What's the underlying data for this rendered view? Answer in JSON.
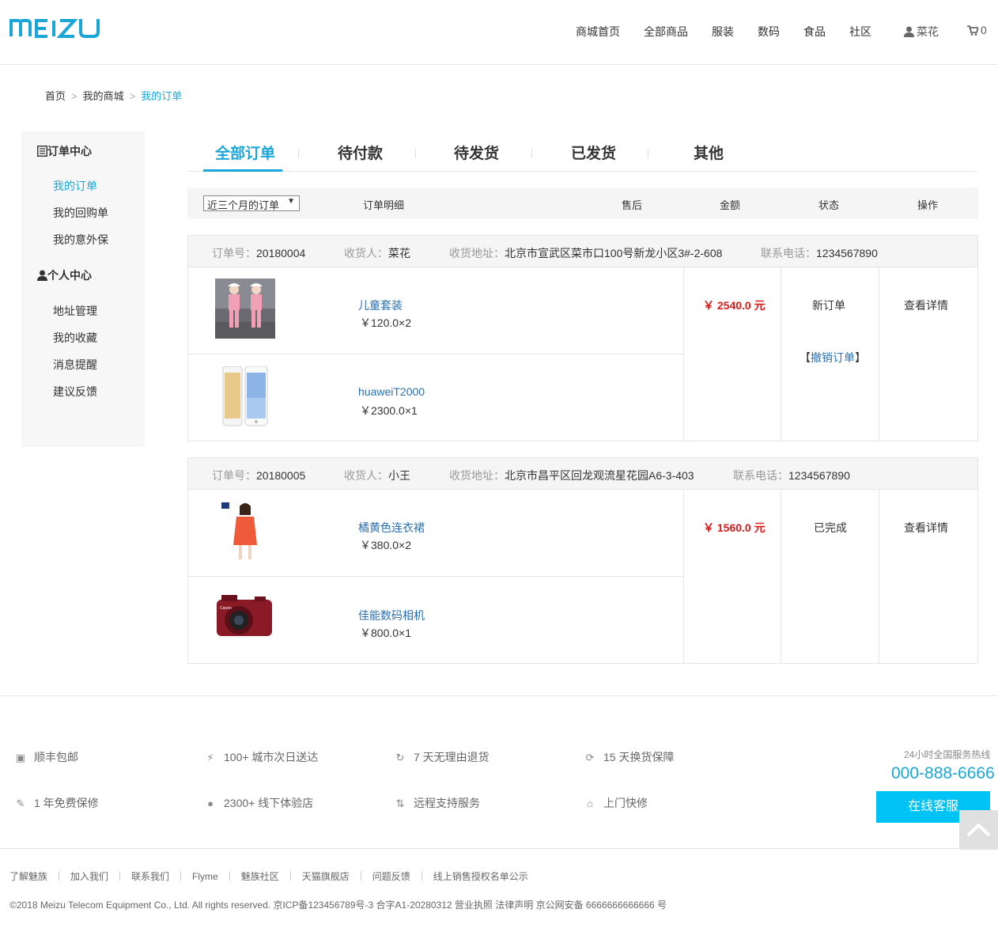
{
  "brand": {
    "logo_text": "MEIZU",
    "accent_color": "#1aa7d8",
    "price_color": "#d91b1b"
  },
  "nav": {
    "items": [
      {
        "label": "商城首页"
      },
      {
        "label": "全部商品"
      },
      {
        "label": "服装"
      },
      {
        "label": "数码"
      },
      {
        "label": "食品"
      },
      {
        "label": "社区"
      }
    ],
    "user": {
      "icon": "user-icon",
      "name": "菜花"
    },
    "cart": {
      "icon": "cart-icon",
      "count": "0"
    }
  },
  "breadcrumb": {
    "home": "首页",
    "sep": ">",
    "mall": "我的商城",
    "current": "我的订单"
  },
  "sidebar": {
    "order_center": {
      "title": "订单中心",
      "icon": "list-icon"
    },
    "order_links": [
      {
        "label": "我的订单"
      },
      {
        "label": "我的回购单"
      },
      {
        "label": "我的意外保"
      }
    ],
    "personal_center": {
      "title": "个人中心",
      "icon": "user-icon"
    },
    "personal_links": [
      {
        "label": "地址管理"
      },
      {
        "label": "我的收藏"
      },
      {
        "label": "消息提醒"
      },
      {
        "label": "建议反馈"
      }
    ]
  },
  "tabs": [
    {
      "label": "全部订单"
    },
    {
      "label": "待付款"
    },
    {
      "label": "待发货"
    },
    {
      "label": "已发货"
    },
    {
      "label": "其他"
    }
  ],
  "columns": {
    "filter_selected": "近三个月的订单",
    "detail": "订单明细",
    "aftersale": "售后",
    "amount": "金额",
    "status": "状态",
    "action": "操作"
  },
  "orders": [
    {
      "order_no_label": "订单号：",
      "order_no": "20180004",
      "receiver_label": "收货人：",
      "receiver": "菜花",
      "address_label": "收货地址：",
      "address": "北京市宣武区菜市口100号新龙小区3#-2-608",
      "phone_label": "联系电话：",
      "phone": "1234567890",
      "items": [
        {
          "name": "儿童套装",
          "price": "￥120.0×2"
        },
        {
          "name": "huaweiT2000",
          "price": "￥2300.0×1"
        }
      ],
      "amount": "￥ 2540.0 元",
      "status": "新订单",
      "cancel": "撤销订单",
      "action": "查看详情"
    },
    {
      "order_no_label": "订单号：",
      "order_no": "20180005",
      "receiver_label": "收货人：",
      "receiver": "小王",
      "address_label": "收货地址：",
      "address": "北京市昌平区回龙观流星花园A6-3-403",
      "phone_label": "联系电话：",
      "phone": "1234567890",
      "items": [
        {
          "name": "橘黄色连衣裙",
          "price": "￥380.0×2"
        },
        {
          "name": "佳能数码相机",
          "price": "￥800.0×1"
        }
      ],
      "amount": "￥ 1560.0 元",
      "status": "已完成",
      "action": "查看详情"
    }
  ],
  "services": [
    {
      "icon": "chat-icon",
      "label": "顺丰包邮"
    },
    {
      "icon": "bolt-icon",
      "label": "100+ 城市次日送达"
    },
    {
      "icon": "refresh-icon",
      "label": "7 天无理由退货"
    },
    {
      "icon": "exchange-icon",
      "label": "15 天换货保障"
    },
    {
      "icon": "wrench-icon",
      "label": "1 年免费保修"
    },
    {
      "icon": "location-icon",
      "label": "2300+ 线下体验店"
    },
    {
      "icon": "transfer-icon",
      "label": "远程支持服务"
    },
    {
      "icon": "home-icon",
      "label": "上门快修"
    }
  ],
  "hotline": {
    "label": "24小时全国服务热线",
    "number": "000-888-6666",
    "button": "在线客服"
  },
  "footer_links": [
    "了解魅族",
    "加入我们",
    "联系我们",
    "Flyme",
    "魅族社区",
    "天猫旗舰店",
    "问题反馈",
    "线上销售授权名单公示"
  ],
  "copyright": "©2018 Meizu Telecom Equipment Co., Ltd. All rights reserved.   京ICP备123456789号-3  合字A1-20280312  营业执照  法律声明  京公网安备 6666666666666 号"
}
